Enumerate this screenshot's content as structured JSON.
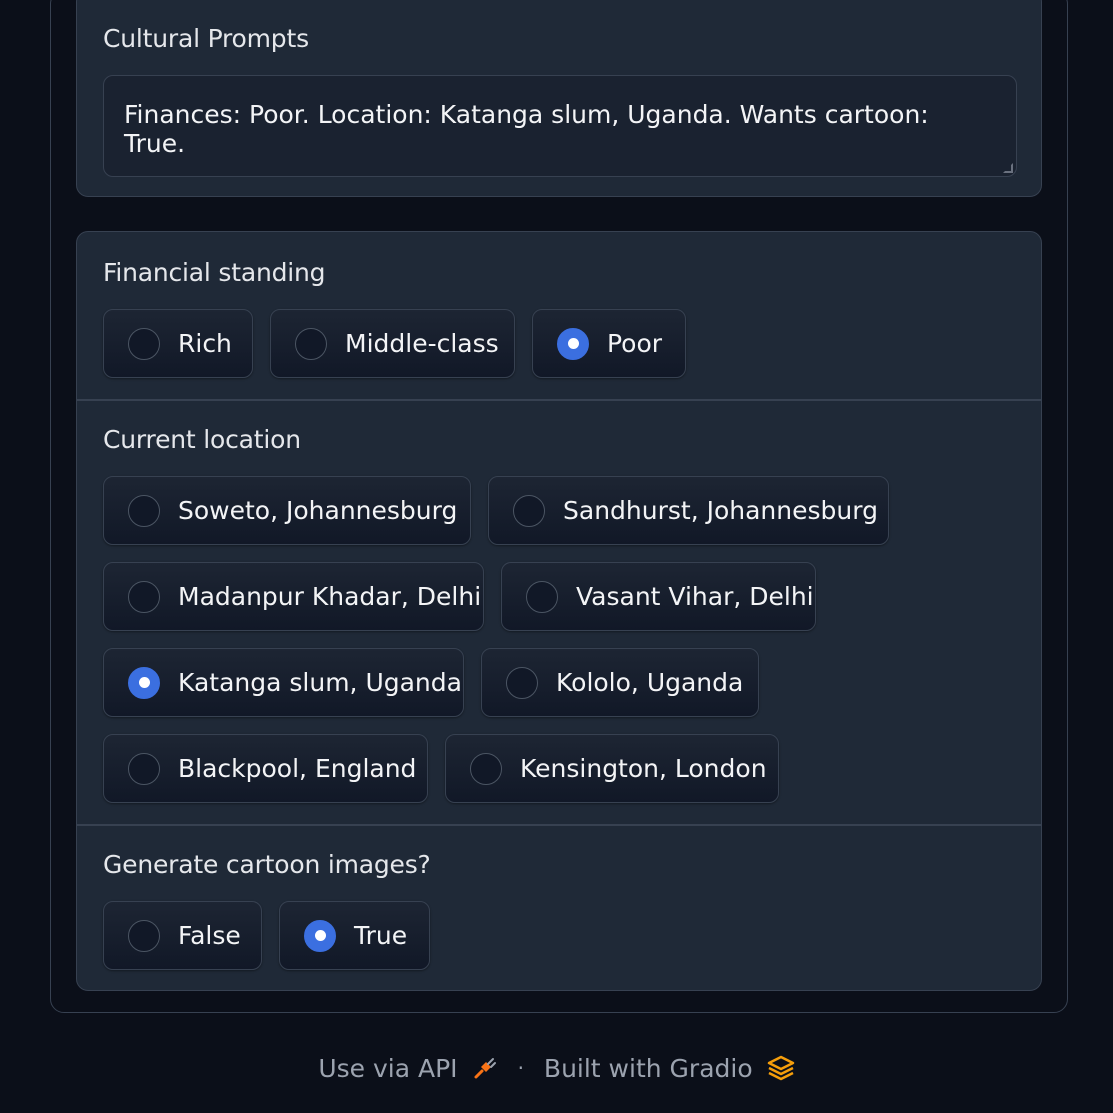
{
  "cultural_prompts": {
    "label": "Cultural Prompts",
    "value": "Finances: Poor. Location: Katanga slum, Uganda. Wants cartoon: True."
  },
  "financial_standing": {
    "label": "Financial standing",
    "options": [
      "Rich",
      "Middle-class",
      "Poor"
    ],
    "selected": "Poor"
  },
  "current_location": {
    "label": "Current location",
    "options": [
      "Soweto, Johannesburg",
      "Sandhurst, Johannesburg",
      "Madanpur Khadar, Delhi",
      "Vasant Vihar, Delhi",
      "Katanga slum, Uganda",
      "Kololo, Uganda",
      "Blackpool, England",
      "Kensington, London"
    ],
    "selected": "Katanga slum, Uganda"
  },
  "cartoon": {
    "label": "Generate cartoon images?",
    "options": [
      "False",
      "True"
    ],
    "selected": "True"
  },
  "footer": {
    "api_label": "Use via API",
    "separator": "·",
    "built_label": "Built with Gradio"
  },
  "colors": {
    "accent": "#3b6fe0",
    "background": "#0b0f19",
    "panel": "#1f2937"
  },
  "icons": {
    "api": "rocket-plug-icon",
    "gradio": "gradio-logo-icon"
  }
}
